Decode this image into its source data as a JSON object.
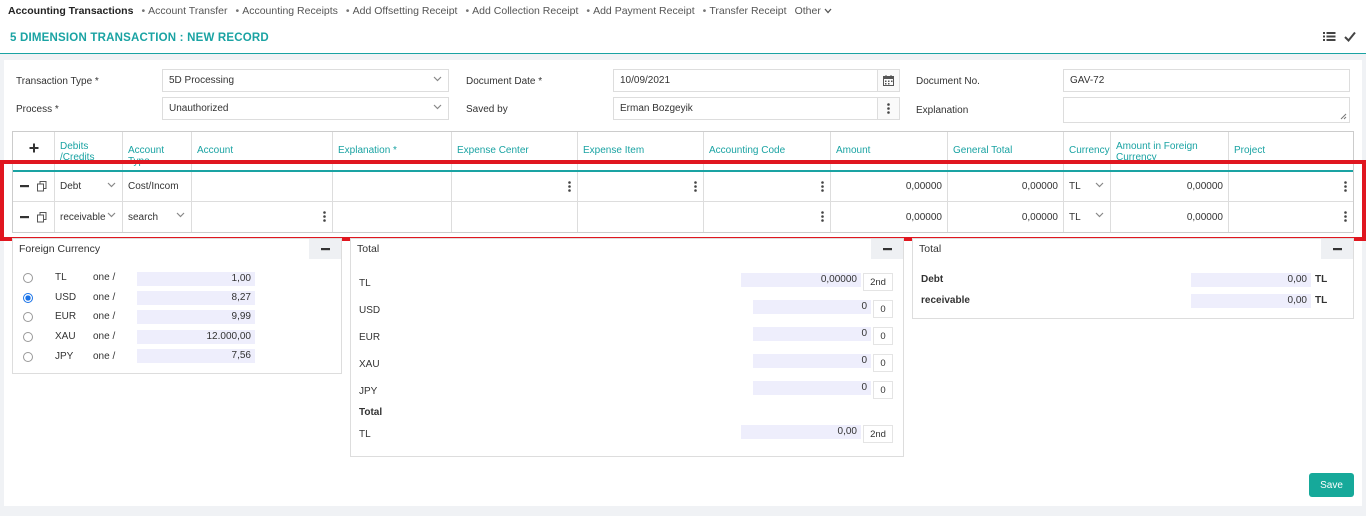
{
  "nav": {
    "active": "Accounting Transactions",
    "items": [
      "Account Transfer",
      "Accounting Receipts",
      "Add Offsetting Receipt",
      "Add Collection Receipt",
      "Add Payment Receipt",
      "Transfer Receipt"
    ],
    "other": "Other"
  },
  "header": {
    "title": "5 DIMENSION TRANSACTION : NEW RECORD"
  },
  "form": {
    "transaction_type": {
      "label": "Transaction Type *",
      "value": "5D Processing"
    },
    "process": {
      "label": "Process *",
      "value": "Unauthorized"
    },
    "document_date": {
      "label": "Document Date *",
      "value": "10/09/2021"
    },
    "saved_by": {
      "label": "Saved by",
      "value": "Erman Bozgeyik"
    },
    "document_no": {
      "label": "Document No.",
      "value": "GAV-72"
    },
    "explanation": {
      "label": "Explanation",
      "value": ""
    }
  },
  "grid": {
    "columns": [
      "Debits /Credits",
      "Account Type",
      "Account",
      "Explanation *",
      "Expense Center",
      "Expense Item",
      "Accounting Code",
      "Amount",
      "General Total",
      "Currency",
      "Amount in Foreign Currency",
      "Project"
    ],
    "rows": [
      {
        "dc": "Debt",
        "account_type": "Cost/Incom",
        "amount": "0,00000",
        "general_total": "0,00000",
        "currency": "TL",
        "foreign_amount": "0,00000"
      },
      {
        "dc": "receivable",
        "account_type": "search",
        "amount": "0,00000",
        "general_total": "0,00000",
        "currency": "TL",
        "foreign_amount": "0,00000"
      }
    ]
  },
  "foreign_currency": {
    "title": "Foreign Currency",
    "rows": [
      {
        "code": "TL",
        "unit": "one /",
        "rate": "1,00",
        "selected": false
      },
      {
        "code": "USD",
        "unit": "one /",
        "rate": "8,27",
        "selected": true
      },
      {
        "code": "EUR",
        "unit": "one /",
        "rate": "9,99",
        "selected": false
      },
      {
        "code": "XAU",
        "unit": "one /",
        "rate": "12.000,00",
        "selected": false
      },
      {
        "code": "JPY",
        "unit": "one /",
        "rate": "7,56",
        "selected": false
      }
    ]
  },
  "totals": {
    "title": "Total",
    "rows": [
      {
        "code": "TL",
        "value": "0,00000",
        "tag": "2nd"
      },
      {
        "code": "USD",
        "value": "0",
        "tag": "0"
      },
      {
        "code": "EUR",
        "value": "0",
        "tag": "0"
      },
      {
        "code": "XAU",
        "value": "0",
        "tag": "0"
      },
      {
        "code": "JPY",
        "value": "0",
        "tag": "0"
      }
    ],
    "subtitle": "Total",
    "sum": {
      "code": "TL",
      "value": "0,00",
      "tag": "2nd"
    }
  },
  "totals_dc": {
    "title": "Total",
    "rows": [
      {
        "label": "Debt",
        "value": "0,00",
        "currency": "TL"
      },
      {
        "label": "receivable",
        "value": "0,00",
        "currency": "TL"
      }
    ]
  },
  "actions": {
    "save": "Save"
  },
  "colors": {
    "accent": "#1aa3a3",
    "highlight": "#e0161f",
    "save": "#16a99a"
  }
}
